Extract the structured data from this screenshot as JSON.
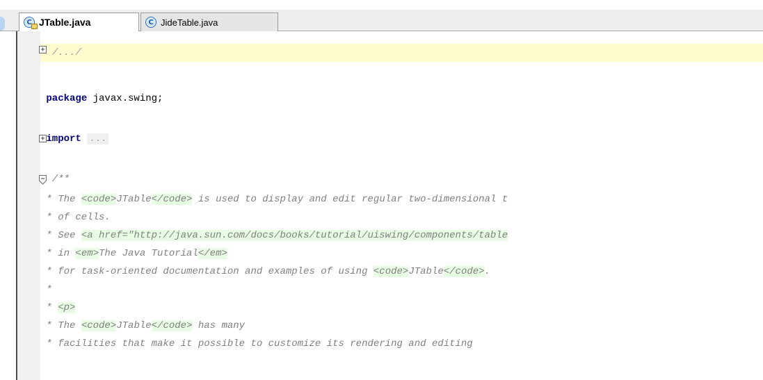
{
  "tabs": [
    {
      "label": "JTable.java",
      "icon": "class-locked-icon",
      "active": true
    },
    {
      "label": "JideTable.java",
      "icon": "class-icon",
      "active": false
    }
  ],
  "icon_glyph": "C",
  "fold_collapsed_glyph": "+",
  "editor": {
    "header_comment": "/.../",
    "package_kw": "package",
    "package_name": " javax.swing;",
    "import_kw": "import",
    "import_fold": "...",
    "javadoc_open": "/**",
    "javadoc": {
      "l1a": " * The ",
      "l1b": "<code>",
      "l1c": "JTable",
      "l1d": "</code>",
      "l1e": " is used to display and edit regular two-dimensional t",
      "l2": " * of cells.",
      "l3a": " * See ",
      "l3b": "<a href=\"http://java.sun.com/docs/books/tutorial/uiswing/components/table",
      "l4a": " * in ",
      "l4b": "<em>",
      "l4c": "The Java Tutorial",
      "l4d": "</em>",
      "l5a": " * for task-oriented documentation and examples of using ",
      "l5b": "<code>",
      "l5c": "JTable",
      "l5d": "</code>",
      "l5e": ".",
      "l6": " *",
      "l7a": " * ",
      "l7b": "<p>",
      "l8a": " * The ",
      "l8b": "<code>",
      "l8c": "JTable",
      "l8d": "</code>",
      "l8e": " has many",
      "l9": " * facilities that make it possible to customize its rendering and editing"
    }
  },
  "colors": {
    "keyword": "#000080",
    "comment": "#808080",
    "tag_bg": "#e8fce4",
    "current_line": "#fffdd0"
  }
}
